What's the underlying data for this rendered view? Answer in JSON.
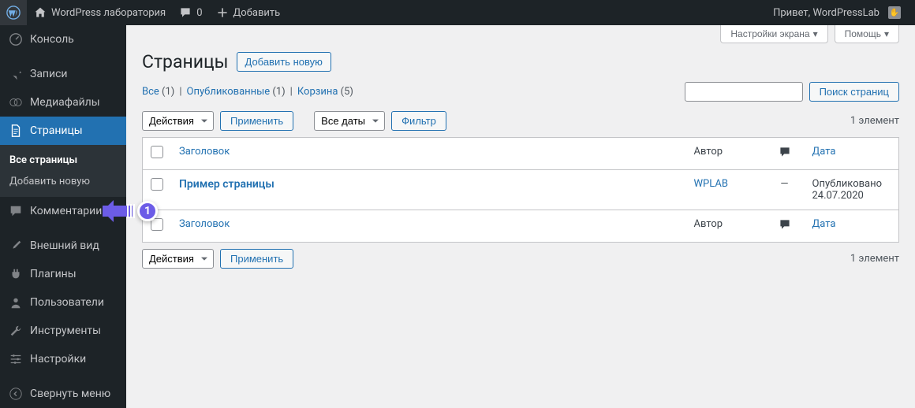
{
  "toolbar": {
    "site_name": "WordPress лаборатория",
    "comments_count": "0",
    "add_new": "Добавить",
    "greeting": "Привет, WordPressLab"
  },
  "sidebar": {
    "items": [
      {
        "label": "Консоль"
      },
      {
        "label": "Записи"
      },
      {
        "label": "Медиафайлы"
      },
      {
        "label": "Страницы"
      },
      {
        "label": "Комментарии"
      },
      {
        "label": "Внешний вид"
      },
      {
        "label": "Плагины"
      },
      {
        "label": "Пользователи"
      },
      {
        "label": "Инструменты"
      },
      {
        "label": "Настройки"
      }
    ],
    "submenu": [
      {
        "label": "Все страницы"
      },
      {
        "label": "Добавить новую"
      }
    ],
    "collapse": "Свернуть меню"
  },
  "screen": {
    "options": "Настройки экрана",
    "help": "Помощь"
  },
  "page": {
    "title": "Страницы",
    "add_new": "Добавить новую"
  },
  "filters": {
    "all": "Все",
    "all_count": "(1)",
    "published": "Опубликованные",
    "published_count": "(1)",
    "trash": "Корзина",
    "trash_count": "(5)"
  },
  "search": {
    "button": "Поиск страниц"
  },
  "bulk": {
    "action": "Действия",
    "apply": "Применить",
    "dates": "Все даты",
    "filter": "Фильтр",
    "count1": "1 элемент",
    "count2": "1 элемент"
  },
  "table": {
    "headers": {
      "title": "Заголовок",
      "author": "Автор",
      "date": "Дата"
    },
    "rows": [
      {
        "title": "Пример страницы",
        "author": "WPLAB",
        "comments": "—",
        "date_status": "Опубликовано",
        "date": "24.07.2020"
      }
    ]
  },
  "annotation": {
    "number": "1"
  }
}
